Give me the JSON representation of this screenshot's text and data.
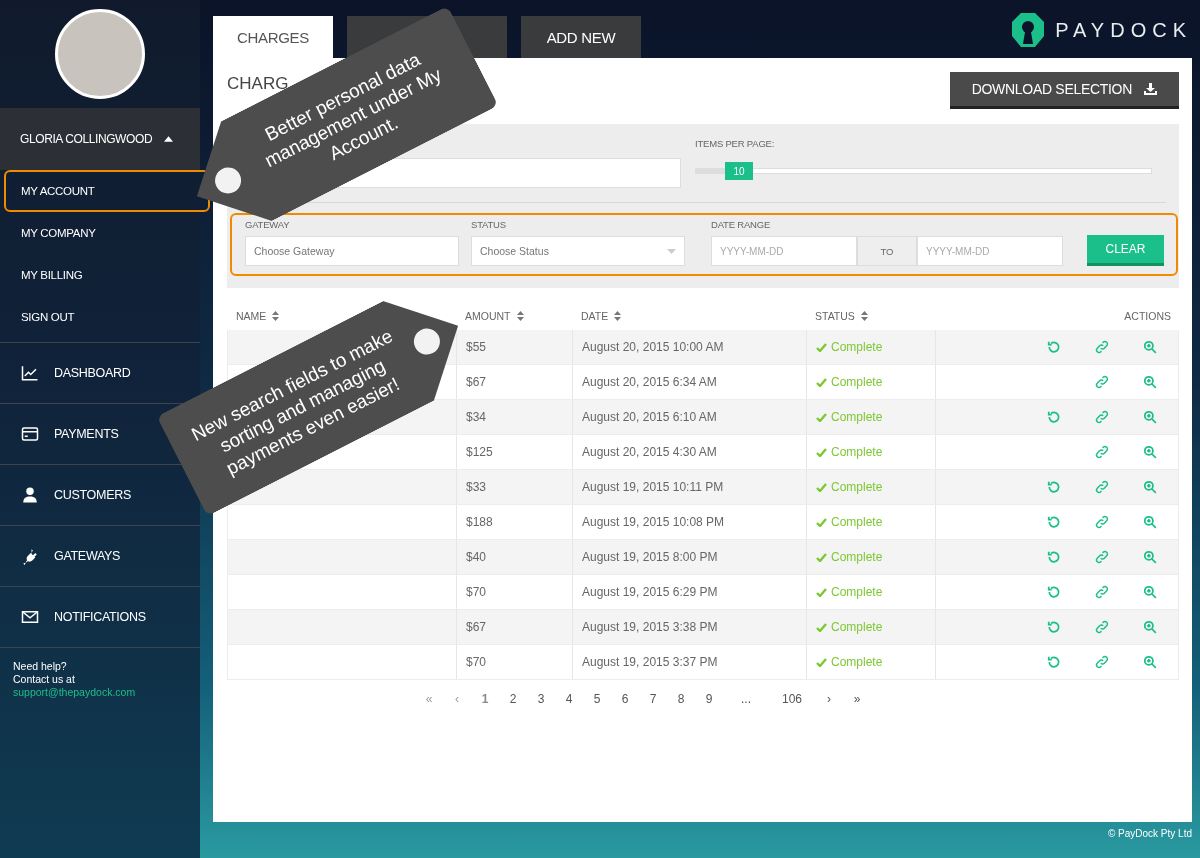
{
  "sidebar": {
    "user_name": "GLORIA COLLINGWOOD",
    "account_menu": [
      {
        "label": "MY ACCOUNT",
        "highlighted": true
      },
      {
        "label": "MY COMPANY",
        "highlighted": false
      },
      {
        "label": "MY BILLING",
        "highlighted": false
      },
      {
        "label": "SIGN OUT",
        "highlighted": false
      }
    ],
    "nav": [
      {
        "label": "DASHBOARD",
        "kind": "chart"
      },
      {
        "label": "PAYMENTS",
        "kind": "card"
      },
      {
        "label": "CUSTOMERS",
        "kind": "user"
      },
      {
        "label": "GATEWAYS",
        "kind": "plug"
      },
      {
        "label": "NOTIFICATIONS",
        "kind": "mail"
      }
    ],
    "help": {
      "text": "Need help?",
      "contact": "Contact us at",
      "email": "support@thepaydock.com"
    }
  },
  "tabs": [
    {
      "label": "CHARGES",
      "selected": true
    },
    {
      "label": "ADD NEW",
      "selected": false
    }
  ],
  "logo": {
    "name": "PAYDOCK"
  },
  "page": {
    "title": "CHARG",
    "download_button": "DOWNLOAD SELECTION",
    "items_per_page": {
      "label": "ITEMS PER PAGE:",
      "value": "10",
      "level": 0.07
    },
    "filters": {
      "highlighted": true,
      "gateway": {
        "label": "GATEWAY",
        "placeholder": "Choose Gateway"
      },
      "status": {
        "label": "STATUS",
        "placeholder": "Choose Status"
      },
      "date_range": {
        "label": "DATE RANGE",
        "from_placeholder": "YYYY-MM-DD",
        "to": "TO",
        "to_placeholder": "YYYY-MM-DD"
      },
      "clear_button": "CLEAR"
    }
  },
  "table": {
    "columns": [
      "NAME",
      "AMOUNT",
      "DATE",
      "STATUS",
      "ACTIONS"
    ],
    "rows": [
      {
        "amount": "$55",
        "date": "August 20, 2015 10:00 AM",
        "status": "Complete",
        "refundable": true
      },
      {
        "amount": "$67",
        "date": "August 20, 2015 6:34 AM",
        "status": "Complete",
        "refundable": false
      },
      {
        "amount": "$34",
        "date": "August 20, 2015 6:10 AM",
        "status": "Complete",
        "refundable": true
      },
      {
        "amount": "$125",
        "date": "August 20, 2015 4:30 AM",
        "status": "Complete",
        "refundable": false
      },
      {
        "amount": "$33",
        "date": "August 19, 2015 10:11 PM",
        "status": "Complete",
        "refundable": true
      },
      {
        "amount": "$188",
        "date": "August 19, 2015 10:08 PM",
        "status": "Complete",
        "refundable": true
      },
      {
        "amount": "$40",
        "date": "August 19, 2015 8:00 PM",
        "status": "Complete",
        "refundable": true
      },
      {
        "amount": "$70",
        "date": "August 19, 2015 6:29 PM",
        "status": "Complete",
        "refundable": true
      },
      {
        "amount": "$67",
        "date": "August 19, 2015 3:38 PM",
        "status": "Complete",
        "refundable": true
      },
      {
        "amount": "$70",
        "date": "August 19, 2015 3:37 PM",
        "status": "Complete",
        "refundable": true
      }
    ]
  },
  "pagination": [
    {
      "label": "«",
      "disabled": true,
      "selected": false
    },
    {
      "label": "‹",
      "disabled": true,
      "selected": false
    },
    {
      "label": "1",
      "disabled": false,
      "selected": true
    },
    {
      "label": "2",
      "disabled": false,
      "selected": false
    },
    {
      "label": "3",
      "disabled": false,
      "selected": false
    },
    {
      "label": "4",
      "disabled": false,
      "selected": false
    },
    {
      "label": "5",
      "disabled": false,
      "selected": false
    },
    {
      "label": "6",
      "disabled": false,
      "selected": false
    },
    {
      "label": "7",
      "disabled": false,
      "selected": false
    },
    {
      "label": "8",
      "disabled": false,
      "selected": false
    },
    {
      "label": "9",
      "disabled": false,
      "selected": false
    },
    {
      "label": "...",
      "disabled": false,
      "selected": false
    },
    {
      "label": "106",
      "disabled": false,
      "selected": false
    },
    {
      "label": "›",
      "disabled": false,
      "selected": false
    },
    {
      "label": "»",
      "disabled": false,
      "selected": false
    }
  ],
  "footer": "© PayDock Pty Ltd",
  "callouts": [
    {
      "text": "Better personal data management under My Account."
    },
    {
      "text": "New search fields to make sorting and managing payments even easier!"
    }
  ]
}
